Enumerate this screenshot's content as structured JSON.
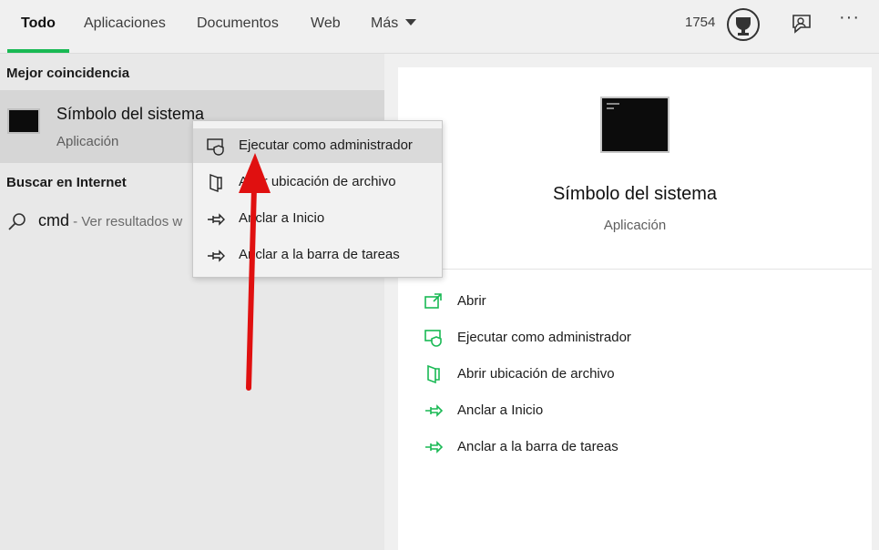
{
  "tabs": [
    {
      "label": "Todo",
      "active": true
    },
    {
      "label": "Aplicaciones",
      "active": false
    },
    {
      "label": "Documentos",
      "active": false
    },
    {
      "label": "Web",
      "active": false
    },
    {
      "label": "Más",
      "active": false
    }
  ],
  "header": {
    "points": "1754"
  },
  "best_match": {
    "section_label": "Mejor coincidencia",
    "title": "Símbolo del sistema",
    "subtitle": "Aplicación"
  },
  "web_search": {
    "section_label": "Buscar en Internet",
    "query": "cmd",
    "hint": " - Ver resultados w"
  },
  "context_menu": {
    "items": [
      {
        "label": "Ejecutar como administrador",
        "icon": "shield-icon"
      },
      {
        "label": "Abrir ubicación de archivo",
        "icon": "file-location-icon"
      },
      {
        "label": "Anclar a Inicio",
        "icon": "pin-icon"
      },
      {
        "label": "Anclar a la barra de tareas",
        "icon": "pin-icon"
      }
    ]
  },
  "detail": {
    "title": "Símbolo del sistema",
    "subtitle": "Aplicación",
    "actions": [
      {
        "label": "Abrir",
        "icon": "open-icon"
      },
      {
        "label": "Ejecutar como administrador",
        "icon": "shield-icon"
      },
      {
        "label": "Abrir ubicación de archivo",
        "icon": "file-location-icon"
      },
      {
        "label": "Anclar a Inicio",
        "icon": "pin-icon"
      },
      {
        "label": "Anclar a la barra de tareas",
        "icon": "pin-icon"
      }
    ]
  },
  "colors": {
    "accent": "#19b954",
    "annotation_arrow": "#e01010"
  }
}
